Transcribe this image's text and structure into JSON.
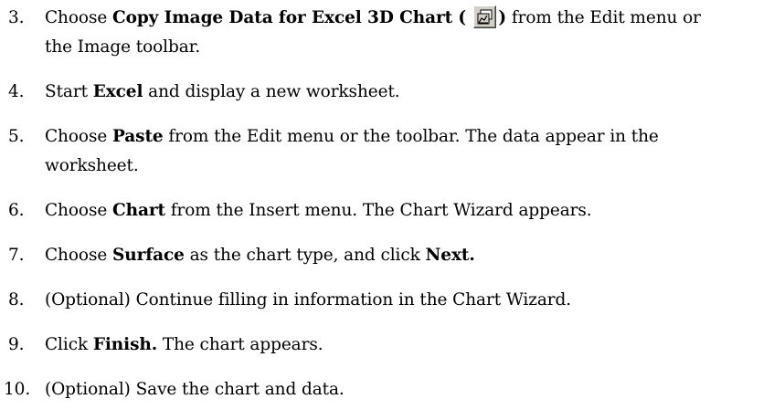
{
  "steps": [
    {
      "number": "3.",
      "parts": [
        "Choose ",
        "Copy Image Data for Excel 3D Chart (",
        ")",
        " from the Edit menu or"
      ],
      "line2": "the Image toolbar.",
      "icon": "chart-copy-icon"
    },
    {
      "number": "4.",
      "parts": [
        "Start ",
        "Excel",
        " and display a new worksheet."
      ]
    },
    {
      "number": "5.",
      "parts": [
        "Choose ",
        "Paste",
        " from the Edit menu or the toolbar. The data appear in the"
      ],
      "line2": "worksheet."
    },
    {
      "number": "6.",
      "parts": [
        "Choose ",
        "Chart",
        " from the Insert menu. The Chart Wizard appears."
      ]
    },
    {
      "number": "7.",
      "parts": [
        "Choose ",
        "Surface",
        " as the chart type, and click ",
        "Next."
      ]
    },
    {
      "number": "8.",
      "text": "(Optional) Continue filling in information in the Chart Wizard."
    },
    {
      "number": "9.",
      "parts": [
        "Click ",
        "Finish.",
        " The chart appears."
      ]
    },
    {
      "number": "10.",
      "text": "(Optional) Save the chart and data."
    }
  ]
}
